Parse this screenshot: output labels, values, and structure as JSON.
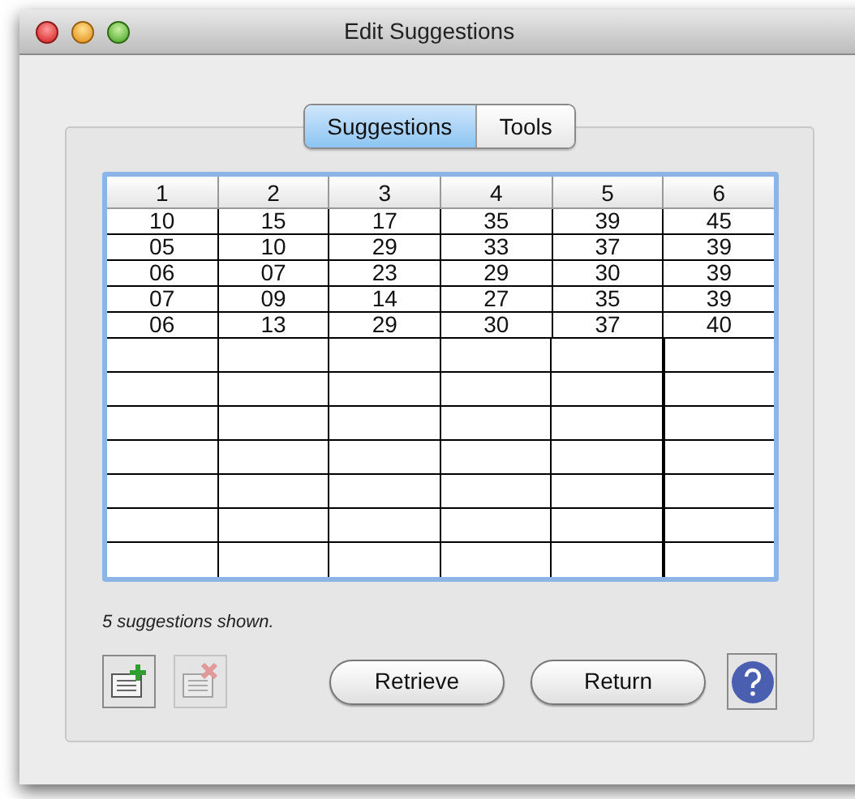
{
  "window": {
    "title": "Edit Suggestions"
  },
  "tabs": [
    {
      "label": "Suggestions",
      "selected": true
    },
    {
      "label": "Tools",
      "selected": false
    }
  ],
  "table": {
    "columns": [
      "1",
      "2",
      "3",
      "4",
      "5",
      "6"
    ],
    "rows": [
      [
        "10",
        "15",
        "17",
        "35",
        "39",
        "45"
      ],
      [
        "05",
        "10",
        "29",
        "33",
        "37",
        "39"
      ],
      [
        "06",
        "07",
        "23",
        "29",
        "30",
        "39"
      ],
      [
        "07",
        "09",
        "14",
        "27",
        "35",
        "39"
      ],
      [
        "06",
        "13",
        "29",
        "30",
        "37",
        "40"
      ]
    ]
  },
  "status": "5 suggestions shown.",
  "icon_buttons": [
    {
      "kind": "add",
      "disabled": false
    },
    {
      "kind": "delete",
      "disabled": true
    }
  ],
  "buttons": [
    "Retrieve",
    "Return"
  ]
}
